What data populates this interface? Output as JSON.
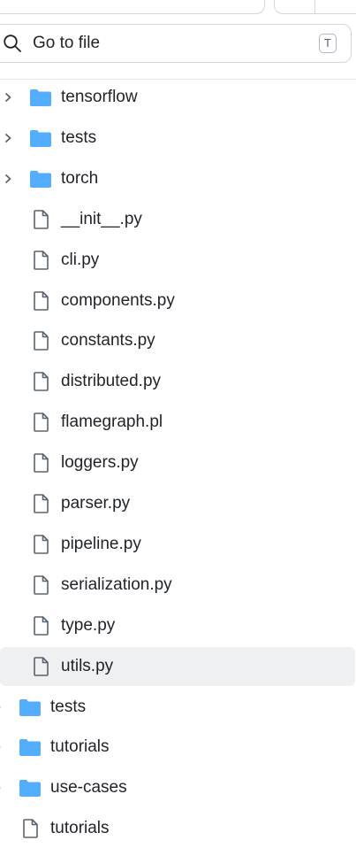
{
  "search": {
    "placeholder": "Go to file",
    "shortcut": "T"
  },
  "colors": {
    "folder": "#54aeff",
    "text": "#1f2328",
    "icon": "#59636e",
    "selected_bg": "#eef0f2",
    "border": "#d0d7de"
  },
  "tree": [
    {
      "name": "tensorflow",
      "type": "folder",
      "depth": 1,
      "selected": false
    },
    {
      "name": "tests",
      "type": "folder",
      "depth": 1,
      "selected": false
    },
    {
      "name": "torch",
      "type": "folder",
      "depth": 1,
      "selected": false
    },
    {
      "name": "__init__.py",
      "type": "file",
      "depth": 1,
      "selected": false
    },
    {
      "name": "cli.py",
      "type": "file",
      "depth": 1,
      "selected": false
    },
    {
      "name": "components.py",
      "type": "file",
      "depth": 1,
      "selected": false
    },
    {
      "name": "constants.py",
      "type": "file",
      "depth": 1,
      "selected": false
    },
    {
      "name": "distributed.py",
      "type": "file",
      "depth": 1,
      "selected": false
    },
    {
      "name": "flamegraph.pl",
      "type": "file",
      "depth": 1,
      "selected": false
    },
    {
      "name": "loggers.py",
      "type": "file",
      "depth": 1,
      "selected": false
    },
    {
      "name": "parser.py",
      "type": "file",
      "depth": 1,
      "selected": false
    },
    {
      "name": "pipeline.py",
      "type": "file",
      "depth": 1,
      "selected": false
    },
    {
      "name": "serialization.py",
      "type": "file",
      "depth": 1,
      "selected": false
    },
    {
      "name": "type.py",
      "type": "file",
      "depth": 1,
      "selected": false
    },
    {
      "name": "utils.py",
      "type": "file",
      "depth": 1,
      "selected": true
    },
    {
      "name": "tests",
      "type": "folder",
      "depth": 0,
      "selected": false
    },
    {
      "name": "tutorials",
      "type": "folder",
      "depth": 0,
      "selected": false
    },
    {
      "name": "use-cases",
      "type": "folder",
      "depth": 0,
      "selected": false
    },
    {
      "name": "tutorials",
      "type": "file",
      "depth": 0,
      "selected": false
    }
  ]
}
